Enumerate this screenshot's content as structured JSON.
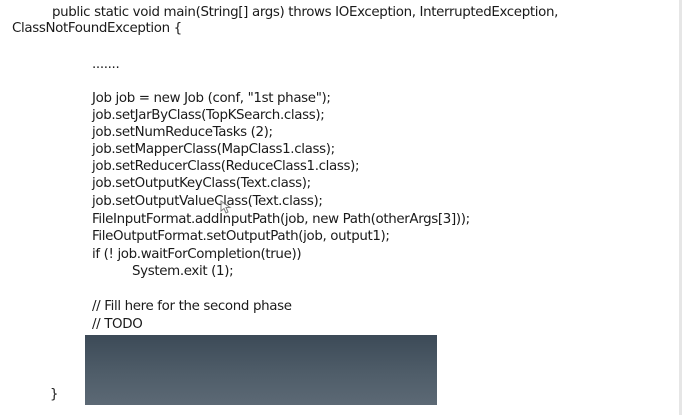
{
  "slide": {
    "signature_line1": "public static void main(String[] args) throws IOException, InterruptedException,",
    "signature_line2": "ClassNotFoundException {",
    "ellipsis": ".......",
    "code_lines": [
      "Job job = new Job (conf, \"1st phase\");",
      "job.setJarByClass(TopKSearch.class);",
      "job.setNumReduceTasks (2);",
      "job.setMapperClass(MapClass1.class);",
      "job.setReducerClass(ReduceClass1.class);",
      "job.setOutputKeyClass(Text.class);",
      "job.setOutputValueClass(Text.class);",
      "FileInputFormat.addInputPath(job, new Path(otherArgs[3]));",
      "FileOutputFormat.setOutputPath(job, output1);",
      "if (! job.waitForCompletion(true))",
      "System.exit (1);"
    ],
    "comment_lines": [
      "// Fill here for the second phase",
      "// TODO"
    ],
    "closing_brace": "}"
  }
}
